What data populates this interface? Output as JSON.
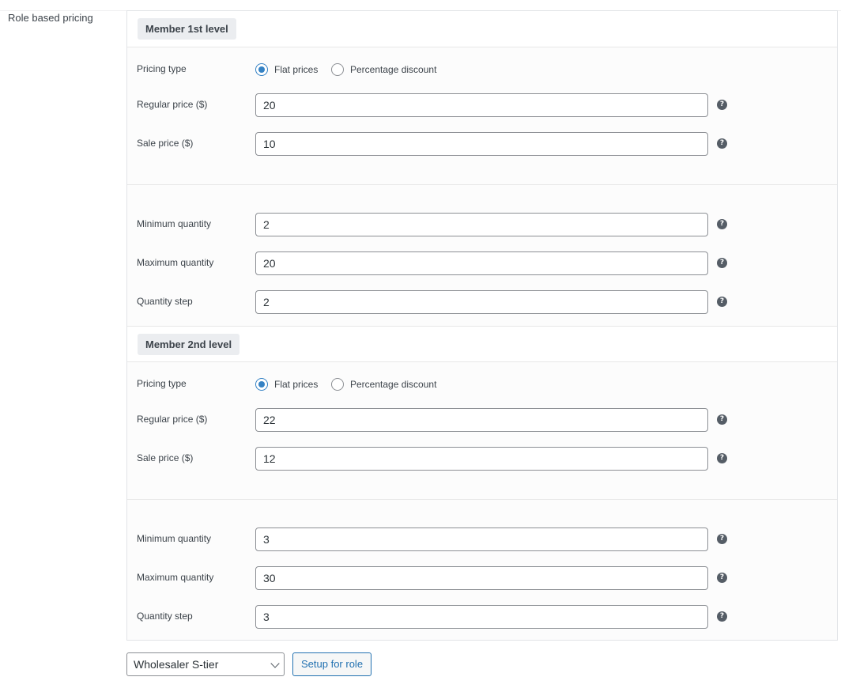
{
  "field_label": "Role based pricing",
  "roles": [
    {
      "name": "Member 1st level",
      "pricing_type_label": "Pricing type",
      "pricing_options": [
        "Flat prices",
        "Percentage discount"
      ],
      "selected_option": "Flat prices",
      "regular_price_label": "Regular price ($)",
      "regular_price": "20",
      "sale_price_label": "Sale price ($)",
      "sale_price": "10",
      "min_qty_label": "Minimum quantity",
      "min_qty": "2",
      "max_qty_label": "Maximum quantity",
      "max_qty": "20",
      "qty_step_label": "Quantity step",
      "qty_step": "2"
    },
    {
      "name": "Member 2nd level",
      "pricing_type_label": "Pricing type",
      "pricing_options": [
        "Flat prices",
        "Percentage discount"
      ],
      "selected_option": "Flat prices",
      "regular_price_label": "Regular price ($)",
      "regular_price": "22",
      "sale_price_label": "Sale price ($)",
      "sale_price": "12",
      "min_qty_label": "Minimum quantity",
      "min_qty": "3",
      "max_qty_label": "Maximum quantity",
      "max_qty": "30",
      "qty_step_label": "Quantity step",
      "qty_step": "3"
    }
  ],
  "help_icon": "question-mark-circle-icon",
  "help_glyph": "?",
  "role_select": {
    "selected": "Wholesaler S-tier"
  },
  "setup_button_label": "Setup for role",
  "colors": {
    "accent": "#2271b1",
    "radio_checked": "#3582c4",
    "border": "#8c8f94"
  }
}
